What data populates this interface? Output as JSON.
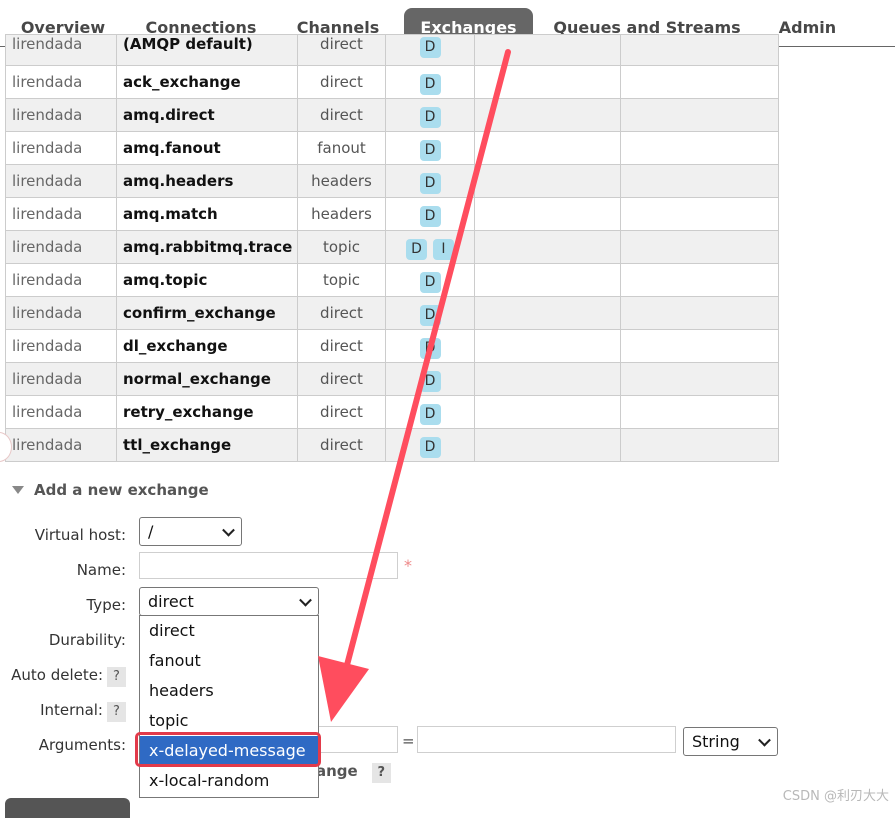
{
  "tabs": [
    "Overview",
    "Connections",
    "Channels",
    "Exchanges",
    "Queues and Streams",
    "Admin"
  ],
  "exchanges": [
    {
      "vhost": "lirendada",
      "name": "(AMQP default)",
      "type": "direct",
      "features": [
        "D"
      ]
    },
    {
      "vhost": "lirendada",
      "name": "ack_exchange",
      "type": "direct",
      "features": [
        "D"
      ]
    },
    {
      "vhost": "lirendada",
      "name": "amq.direct",
      "type": "direct",
      "features": [
        "D"
      ]
    },
    {
      "vhost": "lirendada",
      "name": "amq.fanout",
      "type": "fanout",
      "features": [
        "D"
      ]
    },
    {
      "vhost": "lirendada",
      "name": "amq.headers",
      "type": "headers",
      "features": [
        "D"
      ]
    },
    {
      "vhost": "lirendada",
      "name": "amq.match",
      "type": "headers",
      "features": [
        "D"
      ]
    },
    {
      "vhost": "lirendada",
      "name": "amq.rabbitmq.trace",
      "type": "topic",
      "features": [
        "D",
        "I"
      ]
    },
    {
      "vhost": "lirendada",
      "name": "amq.topic",
      "type": "topic",
      "features": [
        "D"
      ]
    },
    {
      "vhost": "lirendada",
      "name": "confirm_exchange",
      "type": "direct",
      "features": [
        "D"
      ]
    },
    {
      "vhost": "lirendada",
      "name": "dl_exchange",
      "type": "direct",
      "features": [
        "D"
      ]
    },
    {
      "vhost": "lirendada",
      "name": "normal_exchange",
      "type": "direct",
      "features": [
        "D"
      ]
    },
    {
      "vhost": "lirendada",
      "name": "retry_exchange",
      "type": "direct",
      "features": [
        "D"
      ]
    },
    {
      "vhost": "lirendada",
      "name": "ttl_exchange",
      "type": "direct",
      "features": [
        "D"
      ]
    }
  ],
  "add_section": {
    "title": "Add a new exchange",
    "labels": {
      "vhost": "Virtual host:",
      "name": "Name:",
      "type": "Type:",
      "durability": "Durability:",
      "auto_delete": "Auto delete:",
      "internal": "Internal:",
      "arguments": "Arguments:"
    },
    "help_mark": "?",
    "vhost_value": "/",
    "name_value": "",
    "required_mark": "*",
    "type_value": "direct",
    "type_options": [
      "direct",
      "fanout",
      "headers",
      "topic",
      "x-delayed-message",
      "x-local-random"
    ],
    "type_selected_option": "x-delayed-message",
    "args_equals": "=",
    "args_type_value": "String",
    "add_label_suffix": "ange"
  },
  "watermark": "CSDN @利刃大大",
  "colors": {
    "active_tab": "#666666",
    "feature_badge": "#aaddee",
    "row_alt": "#f0f0f0",
    "annotation": "#ff4d5e",
    "selected_option": "#2f6ac4"
  }
}
